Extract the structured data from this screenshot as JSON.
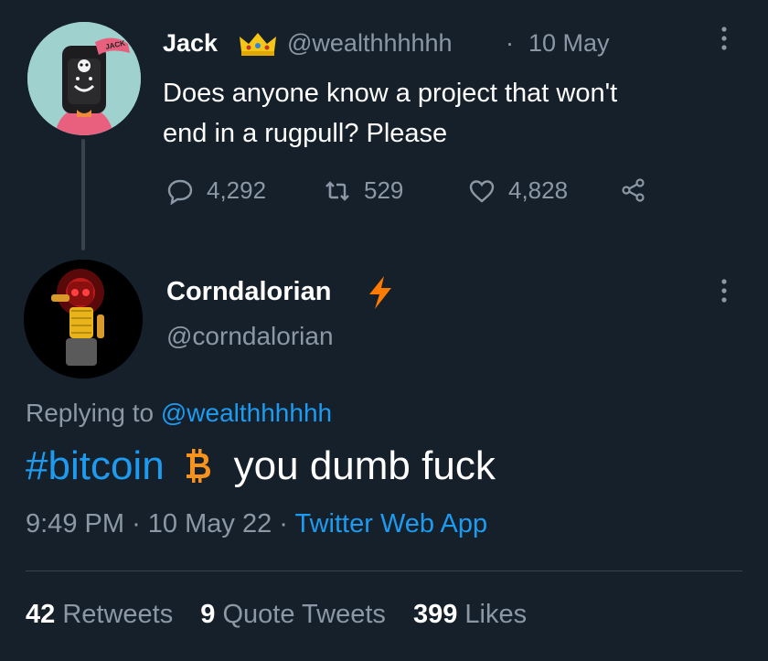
{
  "parent_tweet": {
    "name": "Jack",
    "handle": "@wealthhhhhh",
    "separator": "·",
    "date": "10 May",
    "text_line1": "Does anyone know a project that won't",
    "text_line2": "end in a rugpull? Please",
    "cap_text": "JACK",
    "replies": "4,292",
    "retweets": "529",
    "likes": "4,828"
  },
  "reply_tweet": {
    "name": "Corndalorian",
    "handle": "@corndalorian",
    "replying_prefix": "Replying to",
    "replying_handle": "@wealthhhhhh",
    "hashtag": "#bitcoin",
    "text": "you dumb fuck",
    "time": "9:49 PM",
    "separator": "·",
    "date": "10 May 22",
    "separator2": "·",
    "app": "Twitter Web App"
  },
  "stats": {
    "retweets_count": "42",
    "retweets_label": "Retweets",
    "quotes_count": "9",
    "quotes_label": "Quote Tweets",
    "likes_count": "399",
    "likes_label": "Likes"
  },
  "colors": {
    "background": "#15202b",
    "accent": "#1d9bf0",
    "muted": "#8b98a5",
    "bitcoin": "#f7931a",
    "bolt": "#ff7a00",
    "crown": "#f5c518"
  },
  "icons": {
    "reply": "speech-bubble-icon",
    "retweet": "retweet-icon",
    "like": "heart-icon",
    "share": "share-icon",
    "more": "more-dots-icon",
    "verified_emoji": "crown-icon",
    "name_emoji": "lightning-bolt-icon",
    "text_emoji": "bitcoin-icon"
  }
}
